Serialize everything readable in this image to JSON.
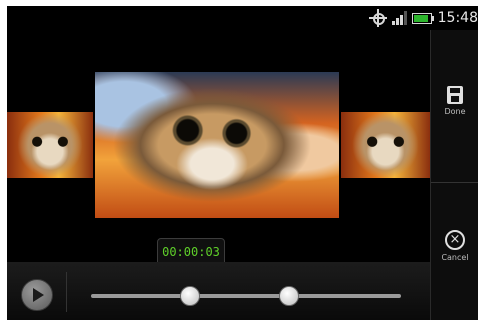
{
  "status_bar": {
    "time": "15:48",
    "icons": [
      "gps-icon",
      "signal-icon",
      "battery-icon"
    ],
    "battery_level": 0.85,
    "signal_level": 0.75
  },
  "actions": {
    "done_label": "Done",
    "done_icon": "save-icon",
    "cancel_label": "Cancel",
    "cancel_icon": "cancel-icon"
  },
  "editor": {
    "current_time": "00:00:03",
    "play_icon": "play-icon",
    "trim_start_position": 0.32,
    "trim_end_position": 0.64
  },
  "colors": {
    "accent_time": "#5fd02a",
    "background": "#000000"
  }
}
